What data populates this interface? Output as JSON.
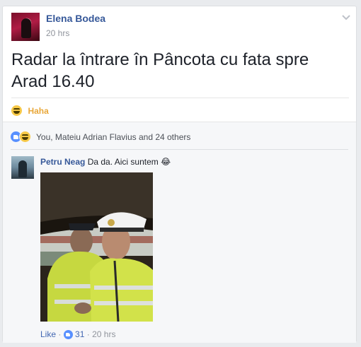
{
  "post": {
    "author": "Elena Bodea",
    "time": "20 hrs",
    "text": "Radar la întrare în Pâncota cu fata spre Arad 16.40"
  },
  "reaction": {
    "label": "Haha"
  },
  "likes": {
    "summary": "You, Mateiu Adrian Flavius and 24 others"
  },
  "comment": {
    "author": "Petru Neag",
    "text": "Da da. Aici suntem",
    "emoji": "😂",
    "actions": {
      "like": "Like",
      "separator": "·",
      "likes_count": "31",
      "time": "20 hrs"
    }
  },
  "colors": {
    "link": "#365899",
    "haha": "#e9a83a",
    "like_blue": "#5890ff",
    "background": "#e9ebee"
  },
  "icons": [
    "chevron-down-icon",
    "haha-reaction-icon",
    "like-reaction-icon"
  ]
}
